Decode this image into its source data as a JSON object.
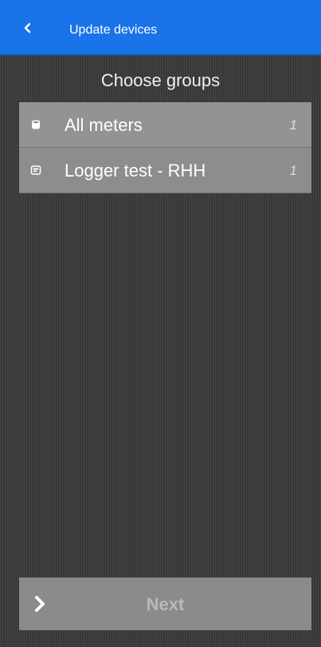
{
  "header": {
    "title": "Update devices",
    "back_icon": "chevron-left-icon",
    "background_color": "#1a73e8"
  },
  "section": {
    "title": "Choose groups"
  },
  "groups": [
    {
      "label": "All meters",
      "count": "1",
      "icon": "cylinder-icon"
    },
    {
      "label": "Logger test - RHH",
      "count": "1",
      "icon": "logger-icon"
    }
  ],
  "footer": {
    "next_label": "Next",
    "next_icon": "chevron-right-icon"
  }
}
